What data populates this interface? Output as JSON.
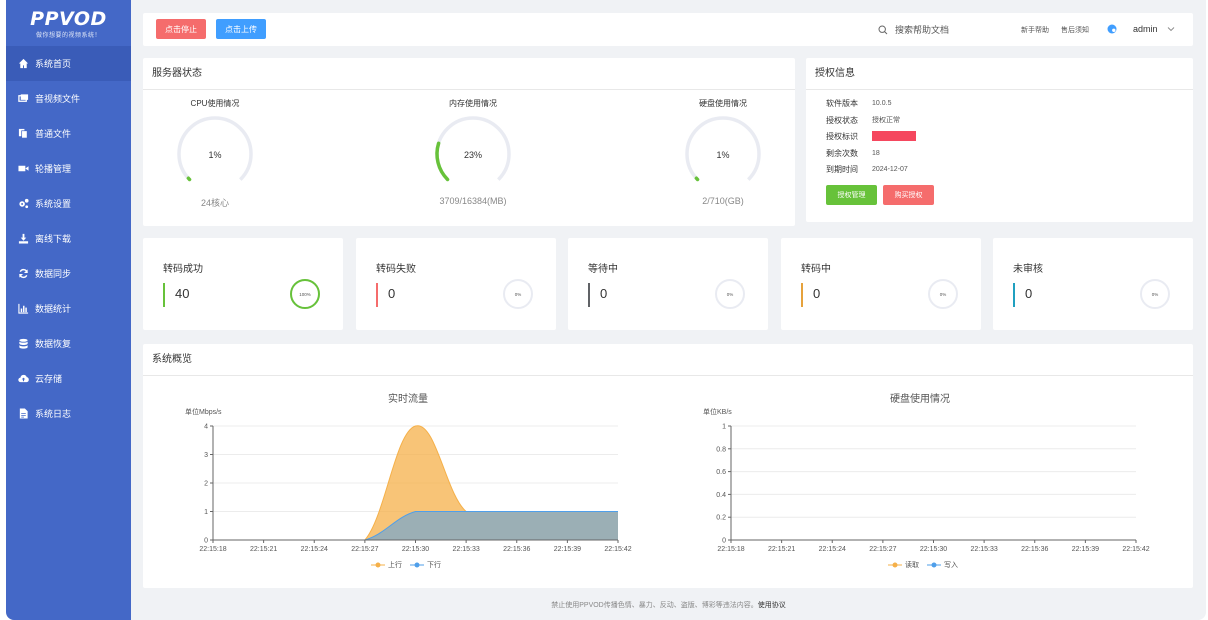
{
  "app": {
    "logo": "PPVOD",
    "logo_sub": "做你想要的视频系统！"
  },
  "sidebar": {
    "items": [
      {
        "label": "系统首页",
        "icon": "home-icon"
      },
      {
        "label": "音视频文件",
        "icon": "media-icon"
      },
      {
        "label": "普通文件",
        "icon": "file-copy-icon"
      },
      {
        "label": "轮播管理",
        "icon": "video-camera-icon"
      },
      {
        "label": "系统设置",
        "icon": "gears-icon"
      },
      {
        "label": "离线下载",
        "icon": "download-icon"
      },
      {
        "label": "数据同步",
        "icon": "sync-icon"
      },
      {
        "label": "数据统计",
        "icon": "bar-chart-icon"
      },
      {
        "label": "数据恢复",
        "icon": "database-icon"
      },
      {
        "label": "云存储",
        "icon": "cloud-upload-icon"
      },
      {
        "label": "系统日志",
        "icon": "document-icon"
      }
    ]
  },
  "topbar": {
    "stop_button": "点击停止",
    "upload_button": "点击上传",
    "search_placeholder": "搜索帮助文档",
    "help_link": "新手帮助",
    "aftersale_link": "售后须知",
    "user": "admin"
  },
  "server_status": {
    "title": "服务器状态",
    "cpu": {
      "label": "CPU使用情况",
      "percent_text": "1%",
      "percent": 1,
      "foot": "24核心"
    },
    "memory": {
      "label": "内存使用情况",
      "percent_text": "23%",
      "percent": 23,
      "foot": "3709/16384(MB)"
    },
    "disk": {
      "label": "硬盘使用情况",
      "percent_text": "1%",
      "percent": 1,
      "foot": "2/710(GB)"
    }
  },
  "license": {
    "title": "授权信息",
    "rows": [
      {
        "key": "软件版本",
        "value": "10.0.5"
      },
      {
        "key": "授权状态",
        "value": "授权正常"
      },
      {
        "key": "授权标识",
        "value": ""
      },
      {
        "key": "剩余次数",
        "value": "18"
      },
      {
        "key": "到期时间",
        "value": "2024-12-07"
      }
    ],
    "manage_button": "授权管理",
    "buy_button": "购买授权"
  },
  "stats": [
    {
      "label": "转码成功",
      "value": "40",
      "percent_text": "100%",
      "percent": 100,
      "color": "#67c23a"
    },
    {
      "label": "转码失败",
      "value": "0",
      "percent_text": "0%",
      "percent": 0,
      "color": "#f56c6c"
    },
    {
      "label": "等待中",
      "value": "0",
      "percent_text": "0%",
      "percent": 0,
      "color": "#606266"
    },
    {
      "label": "转码中",
      "value": "0",
      "percent_text": "0%",
      "percent": 0,
      "color": "#e6a23c"
    },
    {
      "label": "未审核",
      "value": "0",
      "percent_text": "0%",
      "percent": 0,
      "color": "#20a0c0"
    }
  ],
  "overview": {
    "title": "系统概览"
  },
  "chart_data": [
    {
      "type": "area",
      "title": "实时流量",
      "ylabel": "单位Mbps/s",
      "x": [
        "22:15:18",
        "22:15:21",
        "22:15:24",
        "22:15:27",
        "22:15:30",
        "22:15:33",
        "22:15:36",
        "22:15:39",
        "22:15:42"
      ],
      "yticks": [
        "0",
        "1",
        "2",
        "3",
        "4"
      ],
      "ylim": [
        0,
        4
      ],
      "series": [
        {
          "name": "上行",
          "color": "#f5b049",
          "values": [
            0,
            0,
            0,
            0,
            4,
            1,
            1,
            1,
            1
          ]
        },
        {
          "name": "下行",
          "color": "#4f9fea",
          "values": [
            0,
            0,
            0,
            0,
            1,
            1,
            1,
            1,
            1
          ]
        }
      ]
    },
    {
      "type": "area",
      "title": "硬盘使用情况",
      "ylabel": "单位KB/s",
      "x": [
        "22:15:18",
        "22:15:21",
        "22:15:24",
        "22:15:27",
        "22:15:30",
        "22:15:33",
        "22:15:36",
        "22:15:39",
        "22:15:42"
      ],
      "yticks": [
        "0",
        "0.2",
        "0.4",
        "0.6",
        "0.8",
        "1"
      ],
      "ylim": [
        0,
        1
      ],
      "series": [
        {
          "name": "读取",
          "color": "#f5b049",
          "values": [
            0,
            0,
            0,
            0,
            0,
            0,
            0,
            0,
            0
          ]
        },
        {
          "name": "写入",
          "color": "#4f9fea",
          "values": [
            0,
            0,
            0,
            0,
            0,
            0,
            0,
            0,
            0
          ]
        }
      ]
    }
  ],
  "footer": {
    "text": "禁止使用PPVOD传播色情、暴力、反动、盗版、博彩等违法内容。",
    "link": "使用协议"
  },
  "colors": {
    "sidebar": "#4468c7",
    "danger": "#f56c6c",
    "primary": "#409eff",
    "success": "#67c23a"
  }
}
